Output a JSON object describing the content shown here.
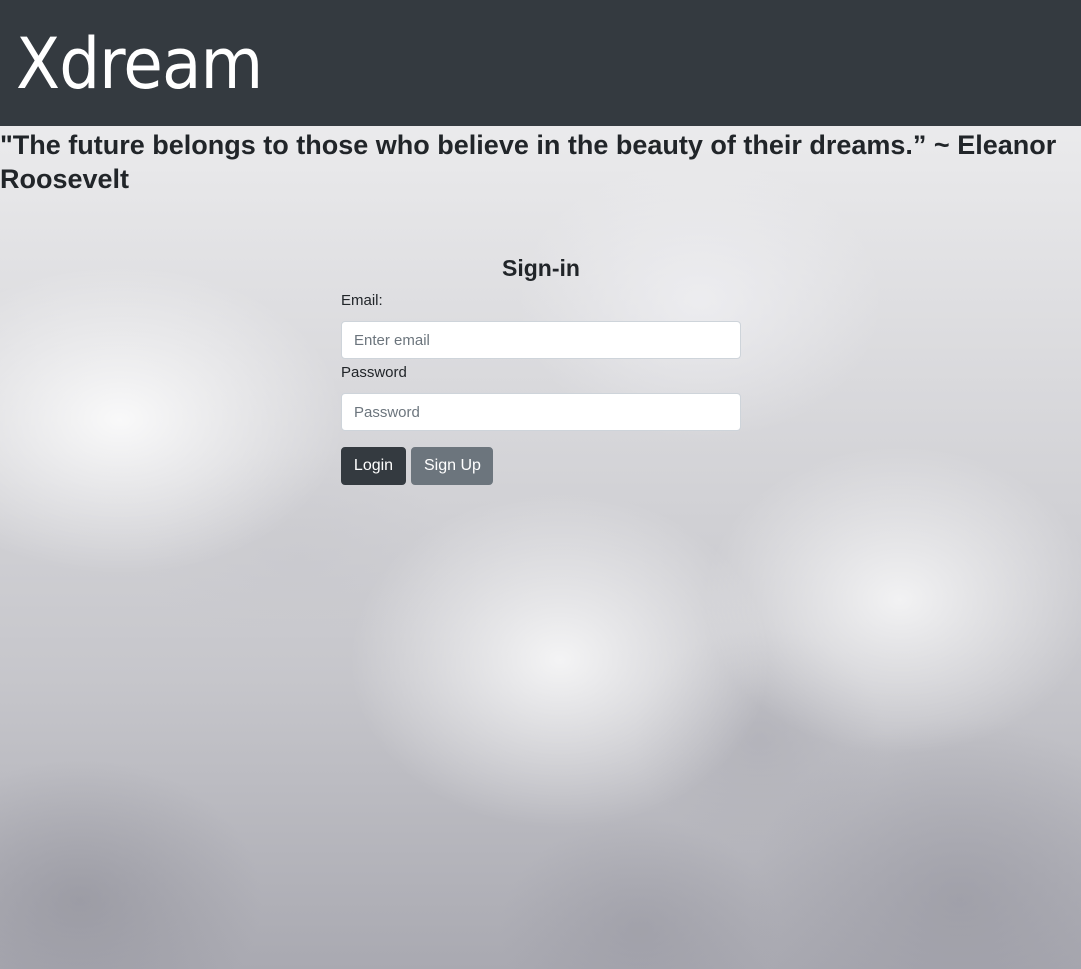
{
  "header": {
    "brand": "Xdream",
    "background": "#343a40"
  },
  "quote": {
    "text": "\"The future belongs to those who believe in the beauty of their dreams.” ~ Eleanor Roosevelt"
  },
  "signin": {
    "title": "Sign-in",
    "email_label": "Email:",
    "email_placeholder": "Enter email",
    "email_value": "",
    "password_label": "Password",
    "password_placeholder": "Password",
    "password_value": "",
    "login_label": "Login",
    "signup_label": "Sign Up"
  },
  "colors": {
    "login_button": "#343a40",
    "signup_button": "#6c757d"
  }
}
